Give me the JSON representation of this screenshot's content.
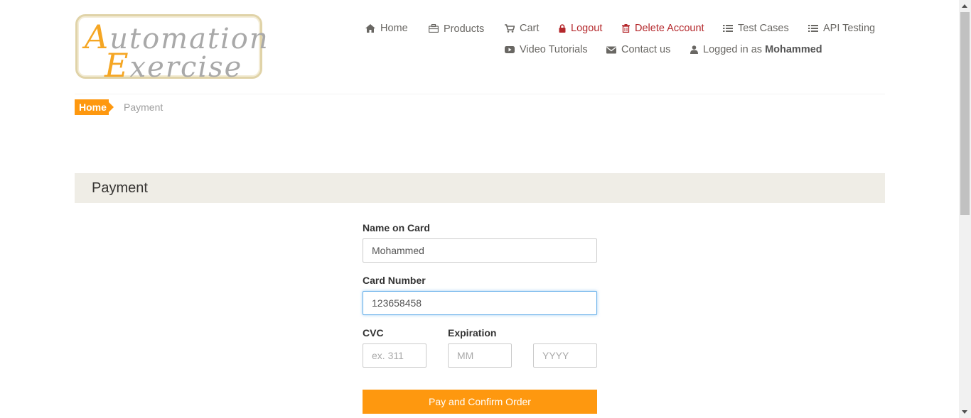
{
  "logo": {
    "line1_cap": "A",
    "line1_rest": "utomation",
    "line2_cap": "E",
    "line2_rest": "xercise"
  },
  "nav": {
    "home": "Home",
    "products": "Products",
    "cart": "Cart",
    "logout": "Logout",
    "delete_account": "Delete Account",
    "test_cases": "Test Cases",
    "api_testing": "API Testing",
    "video_tutorials": "Video Tutorials",
    "contact_us": "Contact us",
    "logged_in_prefix": "Logged in as",
    "username": "Mohammed"
  },
  "breadcrumb": {
    "home": "Home",
    "current": "Payment"
  },
  "payment": {
    "heading": "Payment",
    "name_label": "Name on Card",
    "name_value": "Mohammed",
    "card_label": "Card Number",
    "card_value": "123658458",
    "cvc_label": "CVC",
    "cvc_placeholder": "ex. 311",
    "expiration_label": "Expiration",
    "month_placeholder": "MM",
    "year_placeholder": "YYYY",
    "submit_label": "Pay and Confirm Order"
  },
  "colors": {
    "accent": "#fe980f",
    "danger": "#b4272b",
    "heading_bg": "#efede6"
  }
}
